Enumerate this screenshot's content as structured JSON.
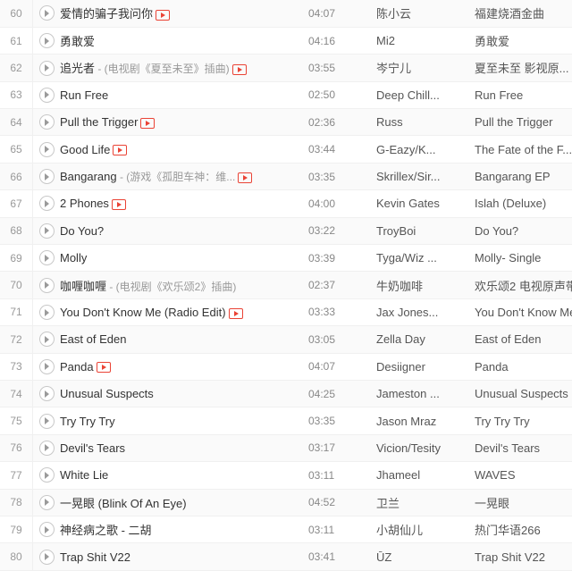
{
  "table": {
    "columns": [
      "index",
      "play",
      "title",
      "duration",
      "artist",
      "album"
    ],
    "rows": [
      {
        "index": "60",
        "title": "爱情的骗子我问你",
        "sub": "",
        "mv": true,
        "duration": "04:07",
        "artist": "陈小云",
        "album": "福建烧酒金曲"
      },
      {
        "index": "61",
        "title": "勇敢爱",
        "sub": "",
        "mv": false,
        "duration": "04:16",
        "artist": "Mi2",
        "album": "勇敢爱"
      },
      {
        "index": "62",
        "title": "追光者",
        "sub": " - (电视剧《夏至未至》插曲)",
        "mv": true,
        "duration": "03:55",
        "artist": "岑宁儿",
        "album": "夏至未至 影视原..."
      },
      {
        "index": "63",
        "title": "Run Free",
        "sub": "",
        "mv": false,
        "duration": "02:50",
        "artist": "Deep Chill...",
        "album": "Run Free"
      },
      {
        "index": "64",
        "title": "Pull the Trigger",
        "sub": "",
        "mv": true,
        "duration": "02:36",
        "artist": "Russ",
        "album": "Pull the Trigger"
      },
      {
        "index": "65",
        "title": "Good Life",
        "sub": "",
        "mv": true,
        "duration": "03:44",
        "artist": "G-Eazy/K...",
        "album": "The Fate of the F..."
      },
      {
        "index": "66",
        "title": "Bangarang",
        "sub": " - (游戏《孤胆车神：维...",
        "mv": true,
        "duration": "03:35",
        "artist": "Skrillex/Sir...",
        "album": "Bangarang EP"
      },
      {
        "index": "67",
        "title": "2 Phones",
        "sub": "",
        "mv": true,
        "duration": "04:00",
        "artist": "Kevin Gates",
        "album": "Islah (Deluxe)"
      },
      {
        "index": "68",
        "title": "Do You?",
        "sub": "",
        "mv": false,
        "duration": "03:22",
        "artist": "TroyBoi",
        "album": "Do You?"
      },
      {
        "index": "69",
        "title": "Molly",
        "sub": "",
        "mv": false,
        "duration": "03:39",
        "artist": "Tyga/Wiz ...",
        "album": "Molly- Single"
      },
      {
        "index": "70",
        "title": "咖喱咖喱",
        "sub": " - (电视剧《欢乐颂2》插曲)",
        "mv": false,
        "duration": "02:37",
        "artist": "牛奶咖啡",
        "album": "欢乐颂2 电视原声带"
      },
      {
        "index": "71",
        "title": "You Don't Know Me (Radio Edit)",
        "sub": "",
        "mv": true,
        "duration": "03:33",
        "artist": "Jax Jones...",
        "album": "You Don't Know Me"
      },
      {
        "index": "72",
        "title": "East of Eden",
        "sub": "",
        "mv": false,
        "duration": "03:05",
        "artist": "Zella Day",
        "album": "East of Eden"
      },
      {
        "index": "73",
        "title": "Panda",
        "sub": "",
        "mv": true,
        "duration": "04:07",
        "artist": "Desiigner",
        "album": "Panda"
      },
      {
        "index": "74",
        "title": "Unusual Suspects",
        "sub": "",
        "mv": false,
        "duration": "04:25",
        "artist": "Jameston ...",
        "album": "Unusual Suspects"
      },
      {
        "index": "75",
        "title": "Try Try Try",
        "sub": "",
        "mv": false,
        "duration": "03:35",
        "artist": "Jason Mraz",
        "album": "Try Try Try"
      },
      {
        "index": "76",
        "title": "Devil's Tears",
        "sub": "",
        "mv": false,
        "duration": "03:17",
        "artist": "Vicion/Tesity",
        "album": "Devil's Tears"
      },
      {
        "index": "77",
        "title": "White Lie",
        "sub": "",
        "mv": false,
        "duration": "03:11",
        "artist": "Jhameel",
        "album": "WAVES"
      },
      {
        "index": "78",
        "title": "一晃眼 (Blink Of An Eye)",
        "sub": "",
        "mv": false,
        "duration": "04:52",
        "artist": "卫兰",
        "album": "一晃眼"
      },
      {
        "index": "79",
        "title": "神经病之歌 - 二胡",
        "sub": "",
        "mv": false,
        "duration": "03:11",
        "artist": "小胡仙儿",
        "album": "热门华语266"
      },
      {
        "index": "80",
        "title": "Trap Shit V22",
        "sub": "",
        "mv": false,
        "duration": "03:41",
        "artist": "ŪZ",
        "album": "Trap Shit V22"
      }
    ]
  },
  "icons": {
    "play": "play-circle-icon",
    "mv": "mv-video-icon"
  },
  "colors": {
    "mv_accent": "#ea4335",
    "row_alt": "#fafafa",
    "text_primary": "#333333",
    "text_secondary": "#999999"
  }
}
